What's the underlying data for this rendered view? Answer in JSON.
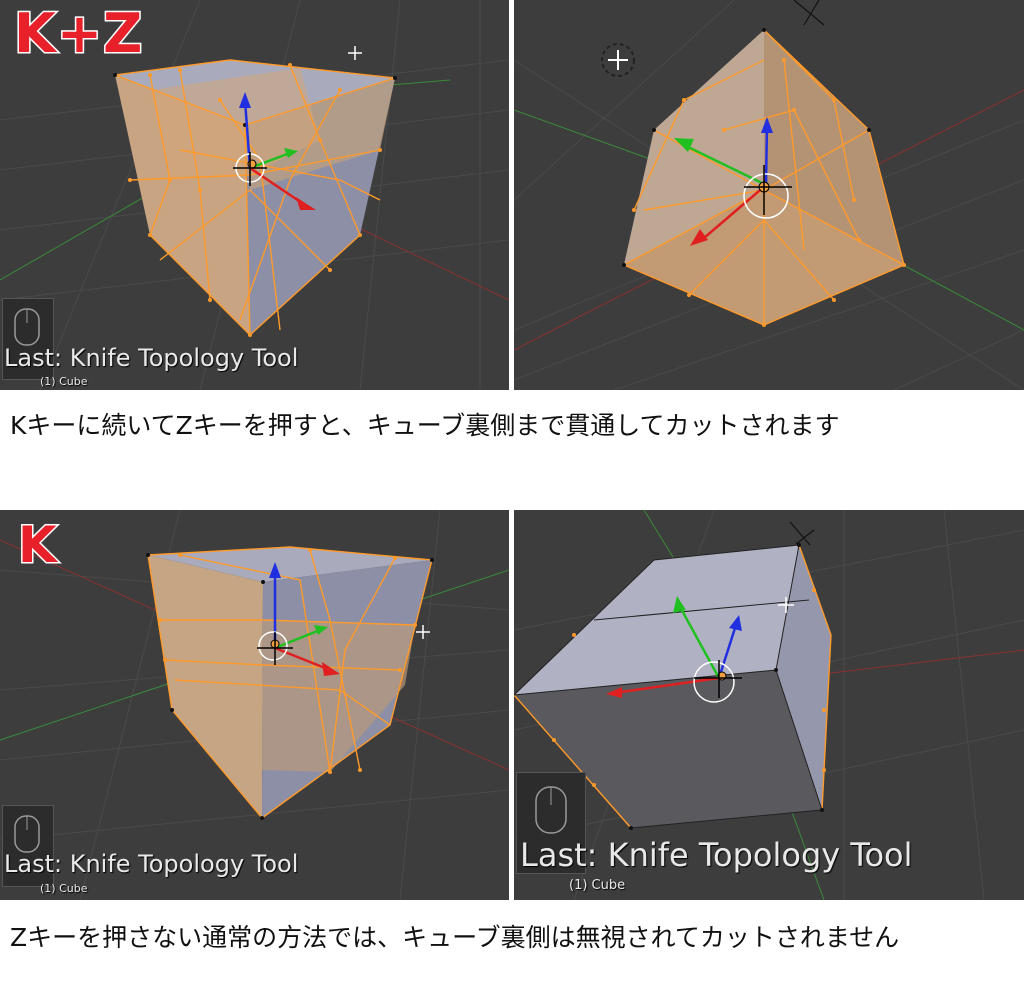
{
  "panels": {
    "top_left": {
      "badge": "K+Z",
      "last_operator": "Last: Knife Topology Tool",
      "object": "(1) Cube"
    },
    "top_right": {},
    "bottom_left": {
      "badge": "K",
      "last_operator": "Last: Knife Topology Tool",
      "object": "(1) Cube"
    },
    "bottom_right": {
      "last_operator": "Last: Knife Topology Tool",
      "object": "(1) Cube"
    }
  },
  "captions": {
    "top": "Kキーに続いてZキーを押すと、キューブ裏側まで貫通してカットされます",
    "bottom": "Zキーを押さない通常の方法では、キューブ裏側は無視されてカットされません"
  },
  "colors": {
    "viewport_bg": "#3d3d3d",
    "cube_face": "#9ea0b0",
    "selected_face": "#c8a07c",
    "edge_selected": "#ff9a2a",
    "badge": "#e8202a",
    "axis_x": "#e02020",
    "axis_y": "#20c020",
    "axis_z": "#2030e0"
  },
  "icons": [
    "mouse-icon",
    "3d-cursor-icon",
    "transform-manipulator-icon",
    "crosshair-icon"
  ]
}
